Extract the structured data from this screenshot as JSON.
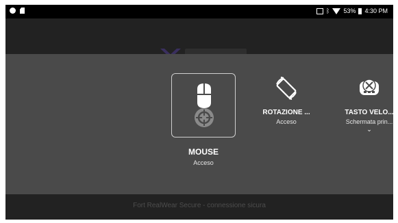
{
  "status_bar": {
    "battery_percent": "53%",
    "time": "4:30 PM",
    "bluetooth_glyph": "ĸ"
  },
  "background_app": {
    "footer_text": "Fort RealWear Secure - connessione sicura"
  },
  "quick_settings": {
    "tiles": [
      {
        "label": "MOUSE",
        "status": "Acceso",
        "icon": "mouse-icon",
        "selected": true
      },
      {
        "label": "ROTAZIONE ...",
        "status": "Acceso",
        "icon": "rotation-icon"
      },
      {
        "label": "TASTO VELO...",
        "status": "Schermata prin...",
        "icon": "keyboard-shortcut-icon",
        "has_dropdown": true
      }
    ]
  },
  "colors": {
    "panel": "#4a4a4a",
    "status_bar": "#000000",
    "background": "#222222"
  }
}
